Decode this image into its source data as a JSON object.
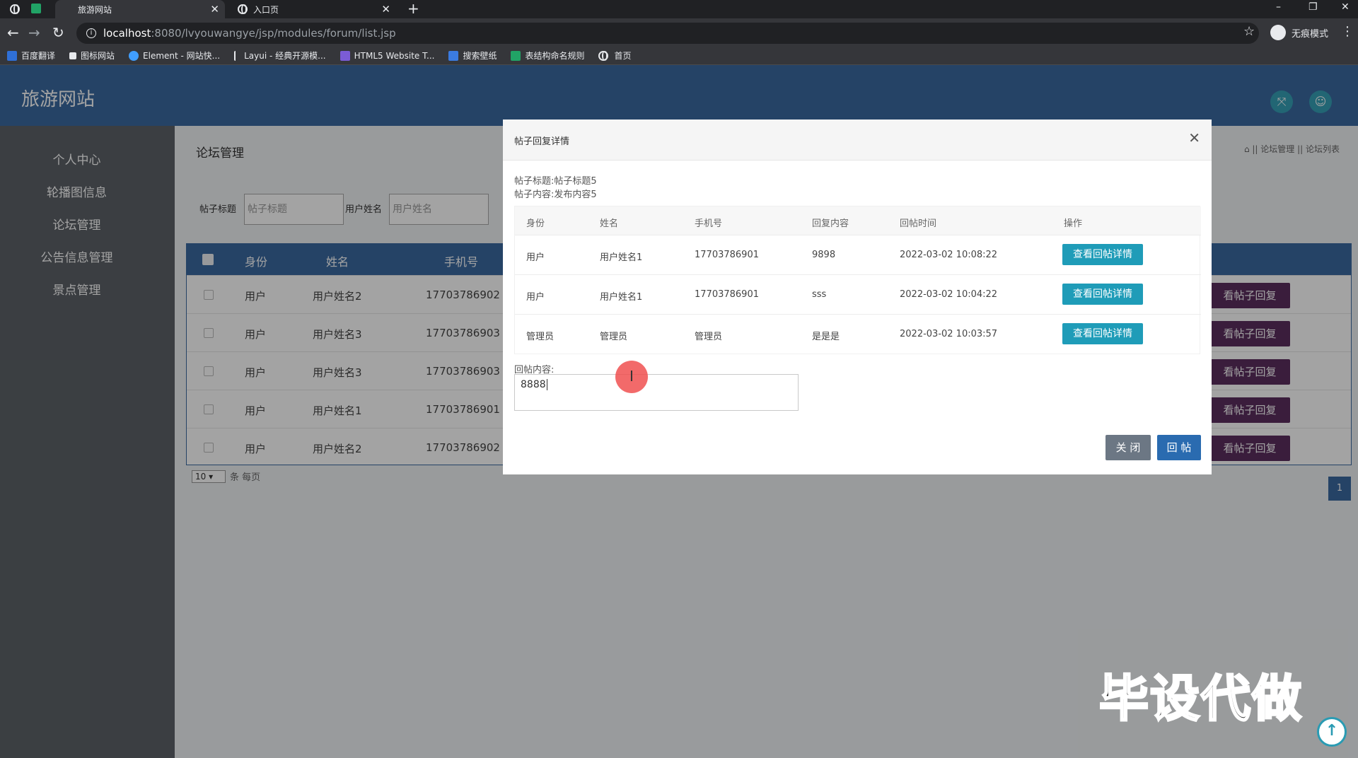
{
  "browser": {
    "tabs": [
      {
        "title": "旅游网站",
        "close": "✕"
      },
      {
        "title": "入口页",
        "close": "✕"
      }
    ],
    "new_tab": "+",
    "window_controls": {
      "minimize": "–",
      "restore": "❐",
      "close": "✕"
    },
    "url": {
      "host": "localhost",
      "rest": ":8080/lvyouwangye/jsp/modules/forum/list.jsp"
    },
    "profile_label": "无痕模式",
    "bookmarks": [
      {
        "label": "百度翻译",
        "color": "#2f6fd6"
      },
      {
        "label": "图标网站",
        "color": "#e8eaed"
      },
      {
        "label": "Element - 网站快...",
        "color": "#409eff"
      },
      {
        "label": "Layui - 经典开源模...",
        "color": "#e8eaed"
      },
      {
        "label": "HTML5 Website T...",
        "color": "#7b5cd6"
      },
      {
        "label": "搜索壁纸",
        "color": "#3b7be0"
      },
      {
        "label": "表结构命名规则",
        "color": "#21a366"
      },
      {
        "label": "首页",
        "color": "#e8eaed"
      }
    ]
  },
  "app": {
    "logo": "旅游网站",
    "sidebar": [
      "个人中心",
      "轮播图信息",
      "论坛管理",
      "公告信息管理",
      "景点管理"
    ],
    "panel_title": "论坛管理",
    "breadcrumb": "⌂ || 论坛管理 || 论坛列表",
    "search": {
      "title_label": "帖子标题",
      "title_placeholder": "帖子标题",
      "user_label": "用户姓名",
      "user_placeholder": "用户姓名"
    },
    "table": {
      "headers": [
        "身份",
        "姓名",
        "手机号"
      ],
      "rows": [
        {
          "role": "用户",
          "name": "用户姓名2",
          "phone": "17703786902",
          "action": "看帖子回复"
        },
        {
          "role": "用户",
          "name": "用户姓名3",
          "phone": "17703786903",
          "action": "看帖子回复"
        },
        {
          "role": "用户",
          "name": "用户姓名3",
          "phone": "17703786903",
          "action": "看帖子回复"
        },
        {
          "role": "用户",
          "name": "用户姓名1",
          "phone": "17703786901",
          "action": "看帖子回复"
        },
        {
          "role": "用户",
          "name": "用户姓名2",
          "phone": "17703786902",
          "action": "看帖子回复"
        }
      ]
    },
    "pager": {
      "page_size": "10",
      "suffix": "条 每页",
      "current_page": "1"
    }
  },
  "modal": {
    "title": "帖子回复详情",
    "close_icon": "✕",
    "post_title": "帖子标题:帖子标题5",
    "post_content": "帖子内容:发布内容5",
    "headers": [
      "身份",
      "姓名",
      "手机号",
      "回复内容",
      "回帖时间",
      "操作"
    ],
    "rows": [
      {
        "role": "用户",
        "name": "用户姓名1",
        "phone": "17703786901",
        "content": "9898",
        "time": "2022-03-02 10:08:22",
        "action": "查看回帖详情"
      },
      {
        "role": "用户",
        "name": "用户姓名1",
        "phone": "17703786901",
        "content": "sss",
        "time": "2022-03-02 10:04:22",
        "action": "查看回帖详情"
      },
      {
        "role": "管理员",
        "name": "管理员",
        "phone": "管理员",
        "content": "是是是",
        "time": "2022-03-02 10:03:57",
        "action": "查看回帖详情"
      }
    ],
    "reply_label": "回帖内容:",
    "reply_value": "8888",
    "btn_close": "关 闭",
    "btn_reply": "回 帖"
  },
  "watermark": "毕设代做",
  "colors": {
    "header": "#3b6aa0",
    "sidebar": "#5d6268",
    "detail_button": "#1f9cb8",
    "row_button": "#5b2e5e"
  }
}
